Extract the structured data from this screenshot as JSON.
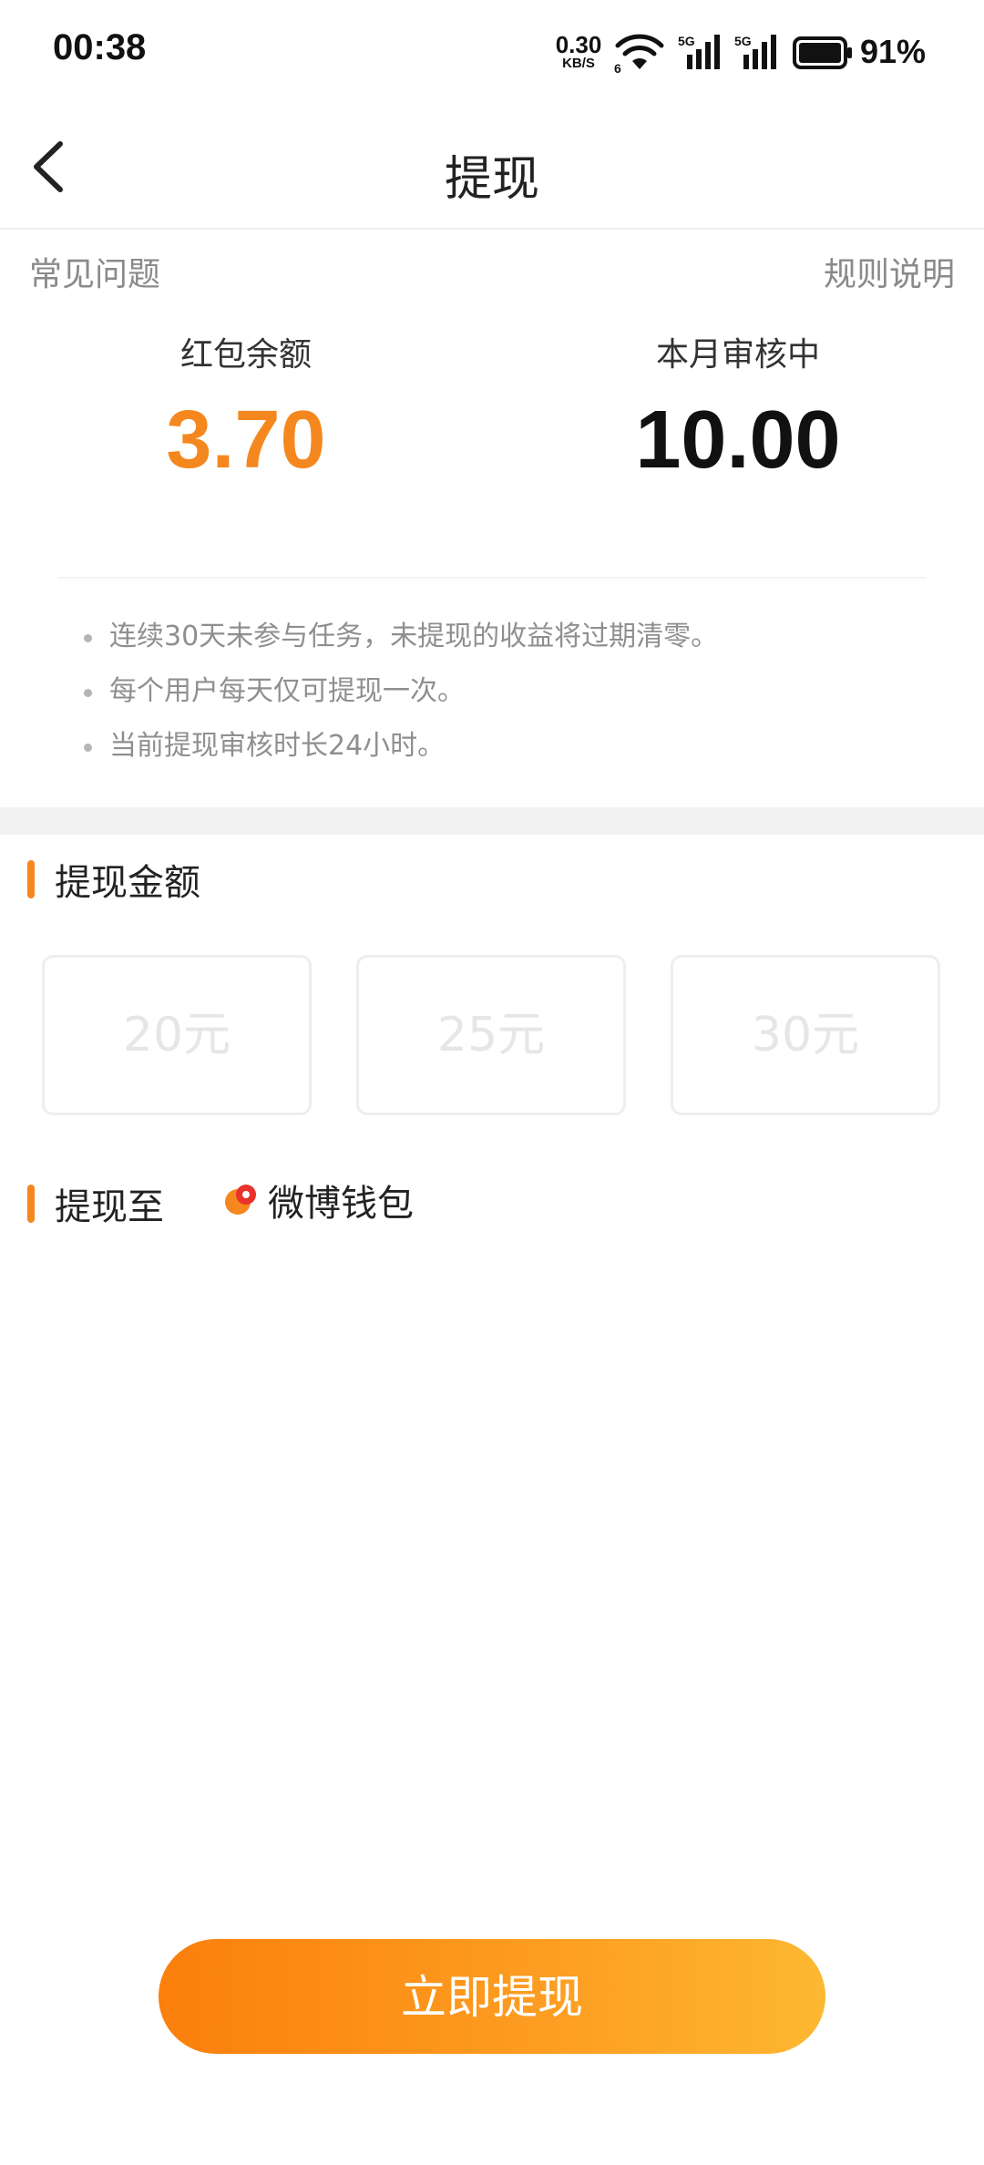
{
  "status_bar": {
    "time": "00:38",
    "net_speed_value": "0.30",
    "net_speed_unit": "KB/S",
    "wifi_label": "6",
    "signal1_label": "5G",
    "signal2_label": "5G",
    "battery": "91%"
  },
  "nav": {
    "title": "提现"
  },
  "links": {
    "faq": "常见问题",
    "rules": "规则说明"
  },
  "balances": {
    "red_packet_label": "红包余额",
    "red_packet_value": "3.70",
    "reviewing_label": "本月审核中",
    "reviewing_value": "10.00"
  },
  "tips": [
    "连续30天未参与任务，未提现的收益将过期清零。",
    "每个用户每天仅可提现一次。",
    "当前提现审核时长24小时。"
  ],
  "amount_section": {
    "title": "提现金额",
    "options": [
      "20元",
      "25元",
      "30元"
    ]
  },
  "target_section": {
    "title": "提现至",
    "wallet_name": "微博钱包"
  },
  "withdraw_button": "立即提现",
  "colors": {
    "accent": "#f5871f",
    "button_gradient_start": "#fb7f0c",
    "button_gradient_end": "#fdb832"
  }
}
